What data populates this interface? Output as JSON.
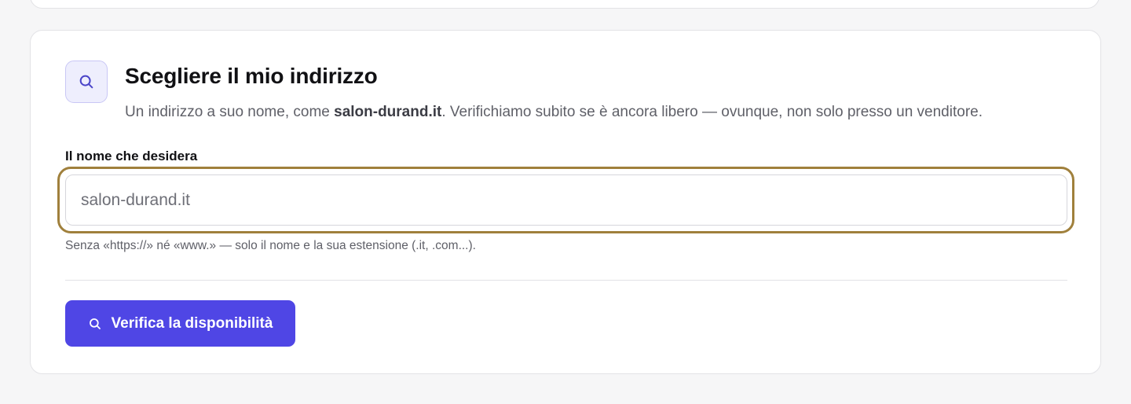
{
  "section": {
    "title": "Scegliere il mio indirizzo",
    "subtitle_before": "Un indirizzo a suo nome, come ",
    "subtitle_example": "salon-durand.it",
    "subtitle_after": ". Verifichiamo subito se è ancora libero — ovunque, non solo presso un venditore.",
    "icon": "search-icon"
  },
  "domain_field": {
    "label": "Il nome che desidera",
    "value": "",
    "placeholder": "salon-durand.it",
    "hint": "Senza «https://» né «www.» — solo il nome e la sua estensione (.it, .com...)."
  },
  "check_button": {
    "label": "Verifica la disponibilità",
    "icon": "search-icon"
  },
  "colors": {
    "accent": "#4f46e5",
    "icon_tile_background": "#eeeefd",
    "focus_ring": "#a0803c",
    "page_background": "#f6f6f7"
  }
}
